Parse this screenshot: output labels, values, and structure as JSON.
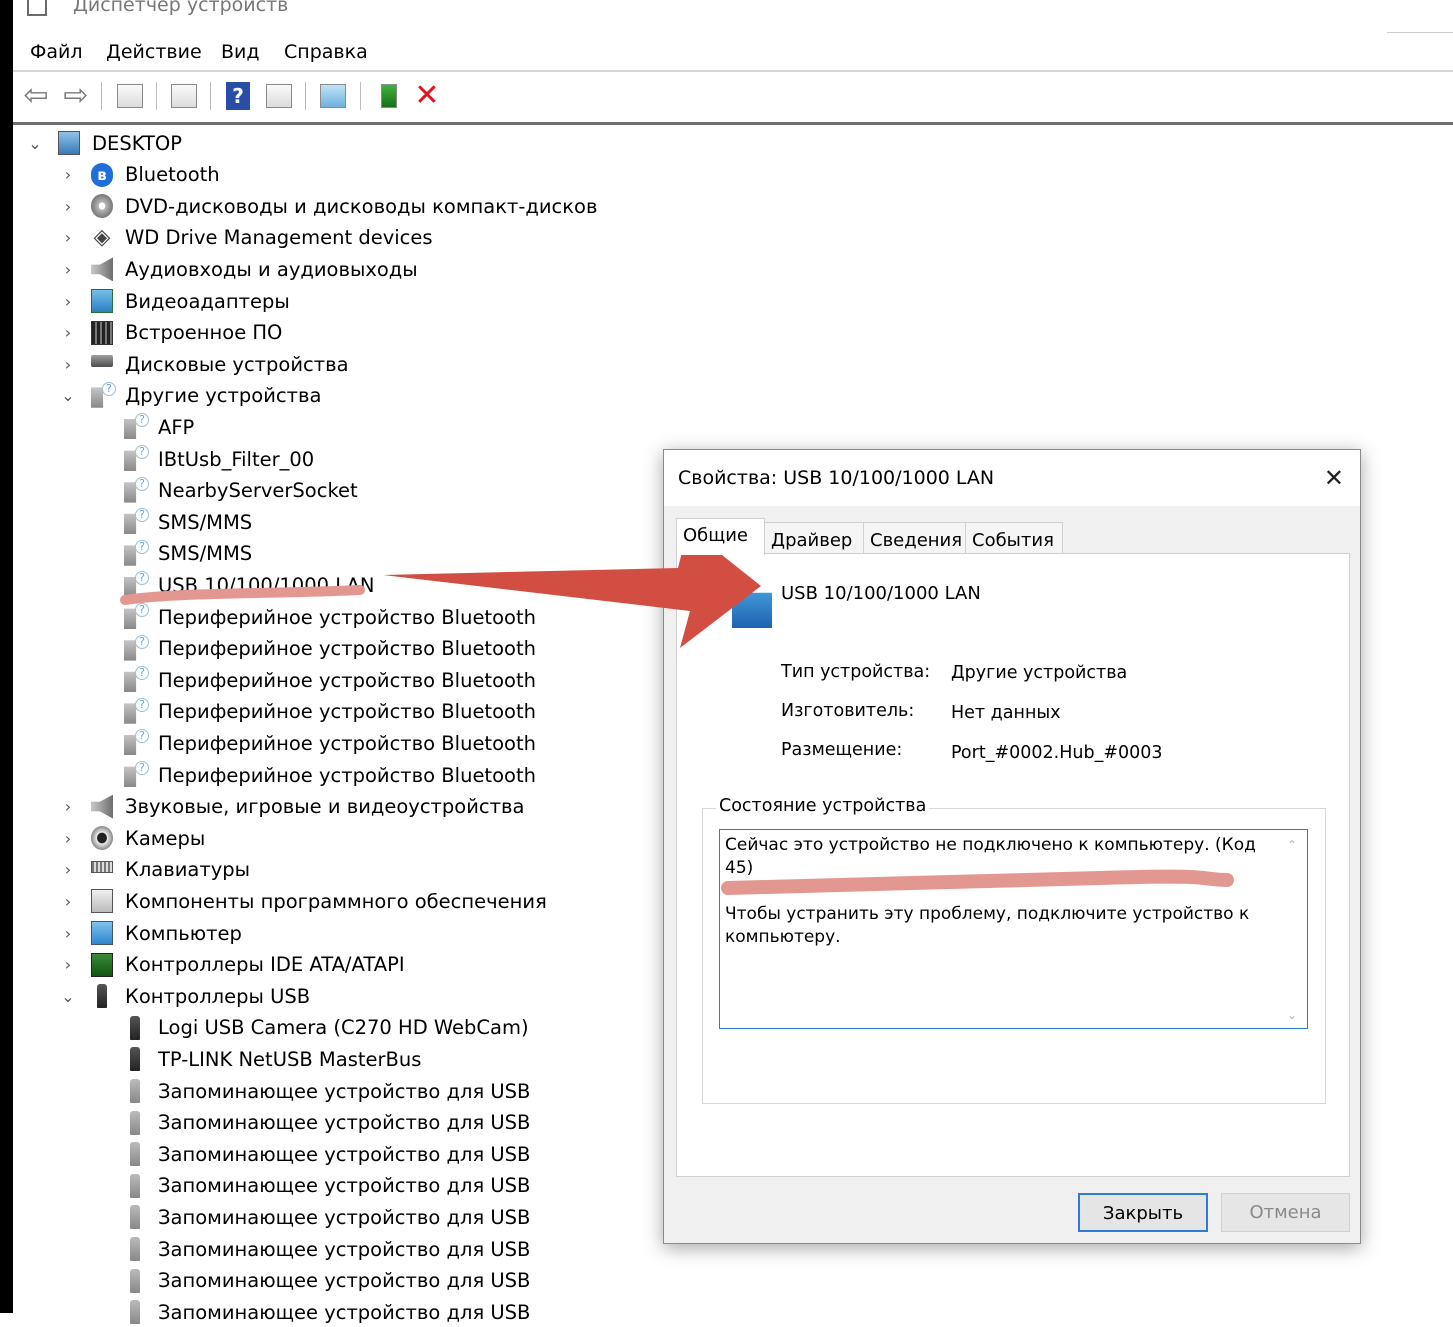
{
  "window": {
    "title": "Диспетчер устройств"
  },
  "menu": [
    "Файл",
    "Действие",
    "Вид",
    "Справка"
  ],
  "toolbar": {
    "buttons": [
      "back-icon",
      "forward-icon",
      "show-hide-console-tree-icon",
      "properties-icon",
      "help-icon",
      "action-pane-icon",
      "scan-hardware-icon",
      "update-driver-icon",
      "uninstall-icon"
    ]
  },
  "tree": {
    "root": "DESKTOP",
    "categories": [
      {
        "label": "Bluetooth",
        "icon": "bluetooth-icon"
      },
      {
        "label": "DVD-дисководы и дисководы компакт-дисков",
        "icon": "dvd-icon"
      },
      {
        "label": "WD Drive Management devices",
        "icon": "wd-icon"
      },
      {
        "label": "Аудиовходы и аудиовыходы",
        "icon": "audio-icon"
      },
      {
        "label": "Видеоадаптеры",
        "icon": "display-adapter-icon"
      },
      {
        "label": "Встроенное ПО",
        "icon": "firmware-icon"
      },
      {
        "label": "Дисковые устройства",
        "icon": "disk-icon"
      },
      {
        "label": "Другие устройства",
        "icon": "unknown-device-icon"
      }
    ],
    "other_devices": [
      "AFP",
      "IBtUsb_Filter_00",
      "NearbyServerSocket",
      "SMS/MMS",
      "SMS/MMS",
      "USB 10/100/1000 LAN",
      "Периферийное устройство Bluetooth",
      "Периферийное устройство Bluetooth",
      "Периферийное устройство Bluetooth",
      "Периферийное устройство Bluetooth",
      "Периферийное устройство Bluetooth",
      "Периферийное устройство Bluetooth"
    ],
    "categories2": [
      {
        "label": "Звуковые, игровые и видеоустройства",
        "icon": "sound-icon"
      },
      {
        "label": "Камеры",
        "icon": "camera-icon"
      },
      {
        "label": "Клавиатуры",
        "icon": "keyboard-icon"
      },
      {
        "label": "Компоненты программного обеспечения",
        "icon": "software-component-icon"
      },
      {
        "label": "Компьютер",
        "icon": "computer-icon"
      },
      {
        "label": "Контроллеры IDE ATA/ATAPI",
        "icon": "ide-controller-icon"
      },
      {
        "label": "Контроллеры USB",
        "icon": "usb-icon"
      }
    ],
    "usb_devices": [
      "Logi USB Camera (C270 HD WebCam)",
      "TP-LINK NetUSB MasterBus",
      "Запоминающее устройство для USB",
      "Запоминающее устройство для USB",
      "Запоминающее устройство для USB",
      "Запоминающее устройство для USB",
      "Запоминающее устройство для USB",
      "Запоминающее устройство для USB",
      "Запоминающее устройство для USB",
      "Запоминающее устройство для USB"
    ]
  },
  "dialog": {
    "title": "Свойства: USB 10/100/1000 LAN",
    "tabs": [
      "Общие",
      "Драйвер",
      "Сведения",
      "События"
    ],
    "device_name": "USB 10/100/1000 LAN",
    "props": [
      {
        "label": "Тип устройства:",
        "value": "Другие устройства"
      },
      {
        "label": "Изготовитель:",
        "value": "Нет данных"
      },
      {
        "label": "Размещение:",
        "value": "Port_#0002.Hub_#0003"
      }
    ],
    "status_group_label": "Состояние устройства",
    "status_text": "Сейчас это устройство не подключено к компьютеру. (Код 45)\n\nЧтобы устранить эту проблему, подключите устройство к компьютеру.",
    "ok_label": "Закрыть",
    "cancel_label": "Отмена"
  },
  "annotation_color": "#d9534a"
}
